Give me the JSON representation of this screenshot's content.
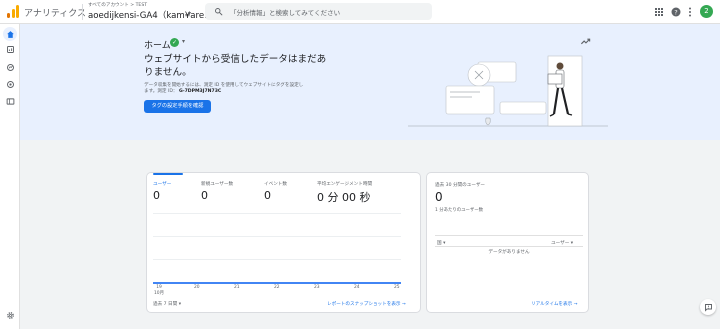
{
  "header": {
    "app_title": "アナリティクス",
    "account_path": "すべてのアカウント > TEST",
    "property_name": "aoedijkensi-GA4（kam¥are…",
    "search_placeholder": "「分析情報」と検索してみてください",
    "avatar_initial": "2"
  },
  "icons": {
    "logo": "analytics-logo-icon",
    "search": "search-icon",
    "apps": "apps-grid-icon",
    "help": "help-icon",
    "more": "more-vert-icon",
    "nav": [
      "home-icon",
      "reports-icon",
      "explore-icon",
      "advertising-icon",
      "library-icon"
    ],
    "settings": "settings-gear-icon",
    "feedback": "feedback-icon",
    "trend": "trending-icon"
  },
  "hero": {
    "title": "ホーム",
    "heading": "ウェブサイトから受信したデータはまだありません。",
    "description_pre": "データ収集を開始するには、測定 ID を使用してウェブサイトにタグを設定します。測定 ID：",
    "measurement_id": "G-7DPM3J7N73C",
    "button_label": "タグの設定手順を確認"
  },
  "metrics_card": {
    "metrics": [
      {
        "label": "ユーザー",
        "value": "0"
      },
      {
        "label": "新規ユーザー数",
        "value": "0"
      },
      {
        "label": "イベント数",
        "value": "0"
      },
      {
        "label": "平均エンゲージメント時間",
        "value": "0 分 00 秒"
      }
    ],
    "x_ticks": [
      {
        "day": "19",
        "month": "10月"
      },
      {
        "day": "20",
        "month": ""
      },
      {
        "day": "21",
        "month": ""
      },
      {
        "day": "22",
        "month": ""
      },
      {
        "day": "23",
        "month": ""
      },
      {
        "day": "24",
        "month": ""
      },
      {
        "day": "25",
        "month": ""
      }
    ],
    "date_range": "過去 7 日間",
    "snapshot_link": "レポートのスナップショットを表示"
  },
  "realtime_card": {
    "title": "過去 30 分間のユーザー",
    "value": "0",
    "subtitle": "1 分あたりのユーザー数",
    "col_country": "国",
    "col_users": "ユーザー",
    "empty_text": "データがありません",
    "link": "リアルタイムを表示"
  },
  "colors": {
    "primary": "#1a73e8",
    "hero_bg": "#e8f0fe",
    "success": "#34a853",
    "logo_orange": "#f9ab00",
    "logo_dark": "#e37400"
  }
}
